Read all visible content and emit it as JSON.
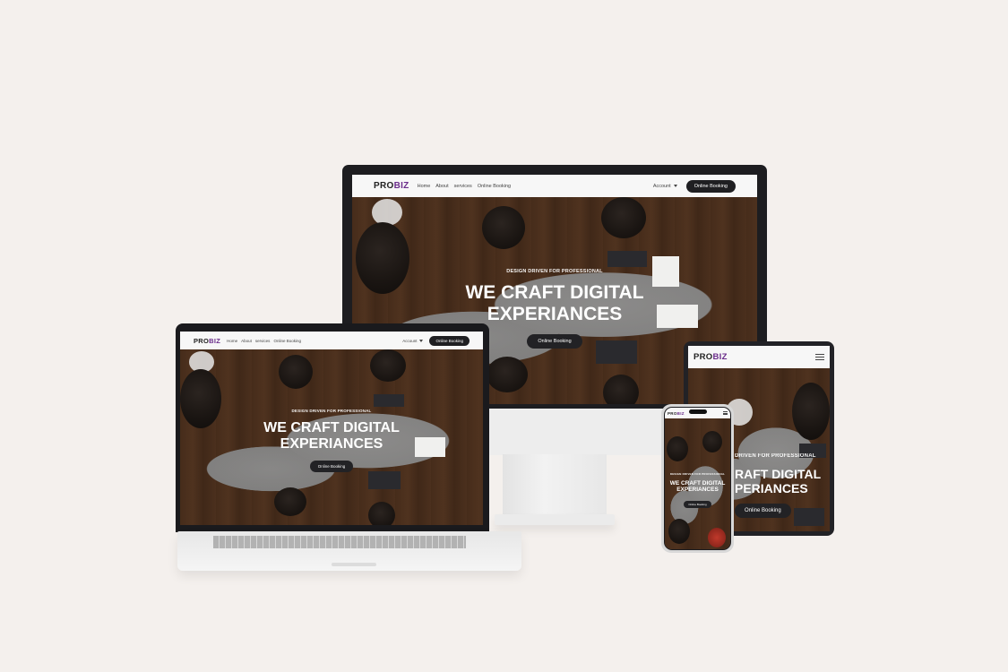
{
  "brand": {
    "pro": "PRO",
    "biz": "BIZ"
  },
  "nav": {
    "links": [
      "Home",
      "About",
      "services",
      "Online Booking"
    ],
    "account_label": "Account",
    "cta_label": "Online Booking"
  },
  "hero": {
    "tagline": "DESIGN DRIVEN FOR PROFESSIONAL",
    "tagline_tablet": "DRIVEN FOR PROFESSIONAL",
    "headline_line1": "WE CRAFT DIGITAL",
    "headline_line2": "EXPERIANCES",
    "headline_tablet_line1": "RAFT DIGITAL",
    "headline_tablet_line2": "PERIANCES",
    "button_label": "Online Booking"
  },
  "icons": {
    "menu": "hamburger-menu-icon",
    "caret": "chevron-down-icon"
  },
  "colors": {
    "accent": "#6a2c8a",
    "button": "#1f1f22",
    "background": "#f4f0ed"
  }
}
